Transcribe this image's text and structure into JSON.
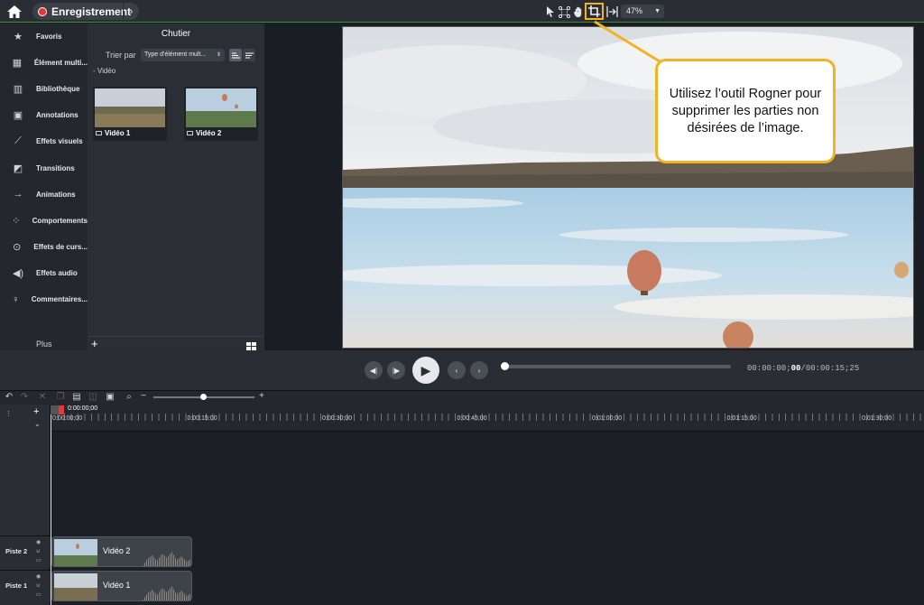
{
  "topbar": {
    "record_label": "Enregistrement",
    "zoom_value": "47%",
    "tools": [
      "select-icon",
      "edit-points-icon",
      "pan-icon",
      "crop-icon",
      "ripple-icon"
    ]
  },
  "sidebar": {
    "items": [
      {
        "label": "Favoris",
        "icon": "star-icon"
      },
      {
        "label": "Élément multi...",
        "icon": "film-icon"
      },
      {
        "label": "Bibliothèque",
        "icon": "library-icon"
      },
      {
        "label": "Annotations",
        "icon": "annotation-icon"
      },
      {
        "label": "Effets visuels",
        "icon": "wand-icon"
      },
      {
        "label": "Transitions",
        "icon": "transition-icon"
      },
      {
        "label": "Animations",
        "icon": "arrow-icon"
      },
      {
        "label": "Comportements",
        "icon": "behavior-icon"
      },
      {
        "label": "Effets de curs...",
        "icon": "cursor-icon"
      },
      {
        "label": "Effets audio",
        "icon": "speaker-icon"
      },
      {
        "label": "Commentaires...",
        "icon": "microphone-icon"
      }
    ],
    "more_label": "Plus"
  },
  "bin": {
    "title": "Chutier",
    "sort_label": "Trier par",
    "sort_value": "Type d'élément mult...",
    "group_label": "Vidéo",
    "media": [
      {
        "label": "Vidéo 1"
      },
      {
        "label": "Vidéo 2"
      }
    ]
  },
  "callout": {
    "text": "Utilisez l’outil Rogner pour supprimer les parties non désirées de l’image."
  },
  "playback": {
    "time_current_prefix": "00:00:00;",
    "time_current_frames": "00",
    "time_total": "/00:00:15;25",
    "progress": 0.0
  },
  "timeline": {
    "playhead_time": "0:00:00;00",
    "ruler_labels": [
      "0:00:00;00",
      "0:00:15;00",
      "0:00:30;00",
      "0:00:45;00",
      "0:01:00;00",
      "0:01:15;00",
      "0:01:30;00"
    ],
    "tracks": [
      {
        "name": "Piste 2",
        "clip": "Vidéo 2"
      },
      {
        "name": "Piste 1",
        "clip": "Vidéo 1"
      }
    ]
  },
  "colors": {
    "accent_highlight": "#f2b322",
    "record_red": "#e83535",
    "track_border_green": "#3a8f3a"
  }
}
